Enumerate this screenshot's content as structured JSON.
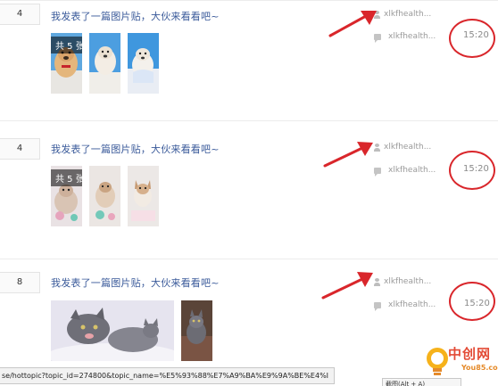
{
  "posts": [
    {
      "reply_count": "4",
      "title": "我发表了一篇图片贴，大伙来看看吧~",
      "image_count_label": "共 5 张",
      "author": "xlkfhealth...",
      "last_reply_user": "xlkfhealth...",
      "time": "15:20"
    },
    {
      "reply_count": "4",
      "title": "我发表了一篇图片贴，大伙来看看吧~",
      "image_count_label": "共 5 张",
      "author": "xlkfhealth...",
      "last_reply_user": "xlkfhealth...",
      "time": "15:20"
    },
    {
      "reply_count": "8",
      "title": "我发表了一篇图片贴，大伙来看看吧~",
      "author": "xlkfhealth...",
      "last_reply_user": "xlkfhealth...",
      "time": "15:20"
    }
  ],
  "status_bar": {
    "url": "se/hottopic?topic_id=274800&topic_name=%E5%93%88%E7%A9%BA%E9%9A%BE%E4%I"
  },
  "hint": {
    "text": "截图(Alt + A)"
  },
  "watermark": {
    "brand": "中创网",
    "domain": "You85.com"
  },
  "colors": {
    "title_link": "#3a5a9a",
    "annotation_red": "#d9262b",
    "meta_gray": "#9a9a9a"
  }
}
